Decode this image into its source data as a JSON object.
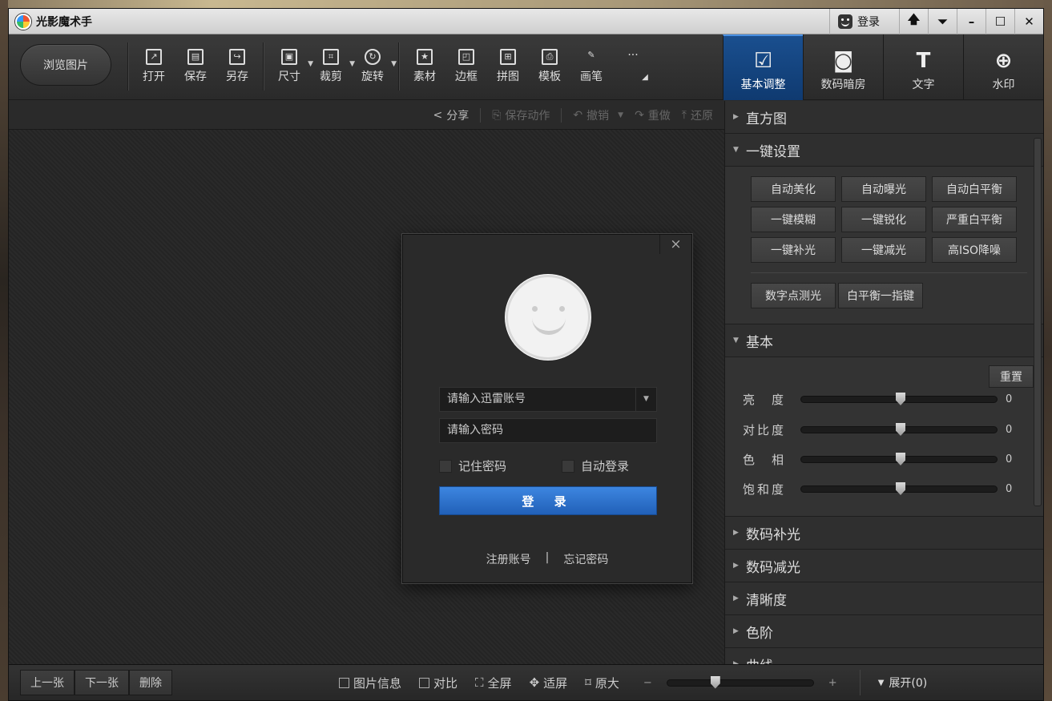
{
  "app": {
    "title": "光影魔术手",
    "login": "登录"
  },
  "window_controls": [
    "🡅",
    "⏷",
    "–",
    "☐",
    "✕"
  ],
  "toolbar": {
    "browse": "浏览图片",
    "tools": [
      {
        "label": "打开",
        "icon": "open-icon"
      },
      {
        "label": "保存",
        "icon": "save-icon"
      },
      {
        "label": "另存",
        "icon": "save-as-icon"
      },
      {
        "label": "尺寸",
        "icon": "resize-icon"
      },
      {
        "label": "裁剪",
        "icon": "crop-icon"
      },
      {
        "label": "旋转",
        "icon": "rotate-icon"
      },
      {
        "label": "素材",
        "icon": "material-icon"
      },
      {
        "label": "边框",
        "icon": "frame-icon"
      },
      {
        "label": "拼图",
        "icon": "collage-icon"
      },
      {
        "label": "模板",
        "icon": "template-icon"
      },
      {
        "label": "画笔",
        "icon": "brush-icon"
      }
    ],
    "more": "···",
    "tabs": [
      {
        "label": "基本调整",
        "glyph": "☑",
        "active": true
      },
      {
        "label": "数码暗房",
        "glyph": "◙",
        "active": false
      },
      {
        "label": "文字",
        "glyph": "T",
        "active": false
      },
      {
        "label": "水印",
        "glyph": "⊕",
        "active": false
      }
    ]
  },
  "canvas_bar": {
    "share": "分享",
    "save_action": "保存动作",
    "undo": "撤销",
    "redo": "重做",
    "restore": "还原"
  },
  "login_dialog": {
    "close": "×",
    "account_placeholder": "请输入迅雷账号",
    "password_placeholder": "请输入密码",
    "remember": "记住密码",
    "auto_login": "自动登录",
    "login_button": "登 录",
    "register": "注册账号",
    "divider": "|",
    "forgot": "忘记密码"
  },
  "panel": {
    "histogram": "直方图",
    "oneclick": {
      "title": "一键设置",
      "buttons": [
        "自动美化",
        "自动曝光",
        "自动白平衡",
        "一键模糊",
        "一键锐化",
        "严重白平衡",
        "一键补光",
        "一键减光",
        "高ISO降噪"
      ],
      "extra": [
        "数字点测光",
        "白平衡一指键"
      ]
    },
    "basic": {
      "title": "基本",
      "reset": "重置",
      "sliders": [
        {
          "label": "亮　度",
          "value": "0",
          "level": 0.5
        },
        {
          "label": "对比度",
          "value": "0",
          "level": 0.5
        },
        {
          "label": "色　相",
          "value": "0",
          "level": 0.5
        },
        {
          "label": "饱和度",
          "value": "0",
          "level": 0.5
        }
      ]
    },
    "collapsed": [
      "数码补光",
      "数码减光",
      "清晰度",
      "色阶",
      "曲线"
    ]
  },
  "bottom": {
    "prev": "上一张",
    "next": "下一张",
    "delete": "删除",
    "info": "图片信息",
    "compare": "对比",
    "fullscreen": "全屏",
    "fit": "适屏",
    "original": "原大",
    "zoom_minus": "−",
    "zoom_plus": "+",
    "expand": "展开(0)"
  }
}
